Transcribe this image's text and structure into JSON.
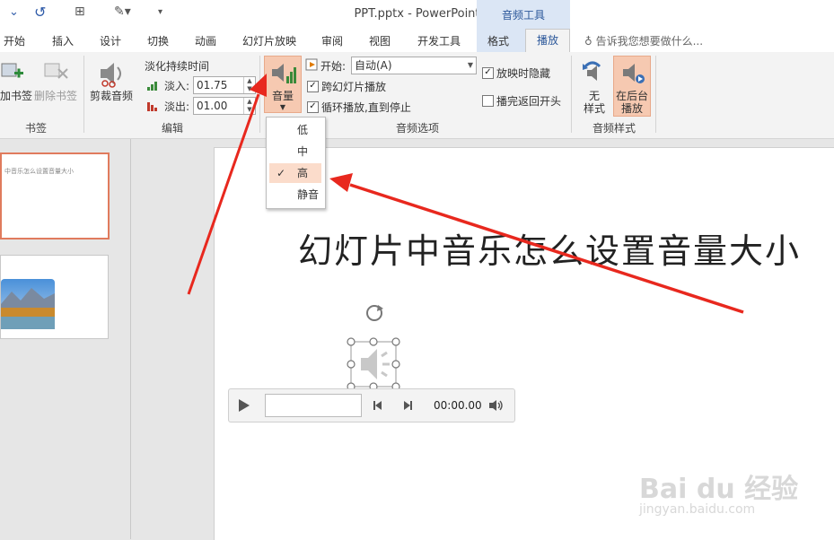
{
  "titlebar": {
    "doc_title": "PPT.pptx - PowerPoint",
    "context_group": "音频工具"
  },
  "tabs": [
    "开始",
    "插入",
    "设计",
    "切换",
    "动画",
    "幻灯片放映",
    "审阅",
    "视图",
    "开发工具",
    "格式",
    "播放"
  ],
  "tell_me": "告诉我您想要做什么...",
  "ribbon": {
    "bookmarks": {
      "add": "加书签",
      "remove": "删除书签",
      "group": "书签"
    },
    "editing": {
      "trim": "剪裁音频",
      "fade_duration": "淡化持续时间",
      "fade_in_label": "淡入:",
      "fade_in_value": "01.75",
      "fade_out_label": "淡出:",
      "fade_out_value": "01.00",
      "group": "编辑"
    },
    "audio_options": {
      "volume": "音量",
      "start_label": "开始:",
      "start_value": "自动(A)",
      "play_across": "跨幻灯片播放",
      "loop": "循环播放,直到停止",
      "hide": "放映时隐藏",
      "rewind": "播完返回开头",
      "group": "音频选项"
    },
    "audio_styles": {
      "no_style_1": "无",
      "no_style_2": "样式",
      "bg_play_1": "在后台",
      "bg_play_2": "播放",
      "group": "音频样式"
    }
  },
  "volume_menu": [
    "低",
    "中",
    "高",
    "静音"
  ],
  "volume_selected": "高",
  "slide": {
    "title": "幻灯片中音乐怎么设置音量大小",
    "thumb_text": "中音乐怎么设置音量大小"
  },
  "player": {
    "time": "00:00.00"
  },
  "watermark": {
    "main": "Bai du 经验",
    "sub": "jingyan.baidu.com"
  },
  "colors": {
    "accent": "#2b579a",
    "highlight": "#f6c9b1",
    "arrow": "#e8281e",
    "thumb_border": "#e07b5d"
  }
}
